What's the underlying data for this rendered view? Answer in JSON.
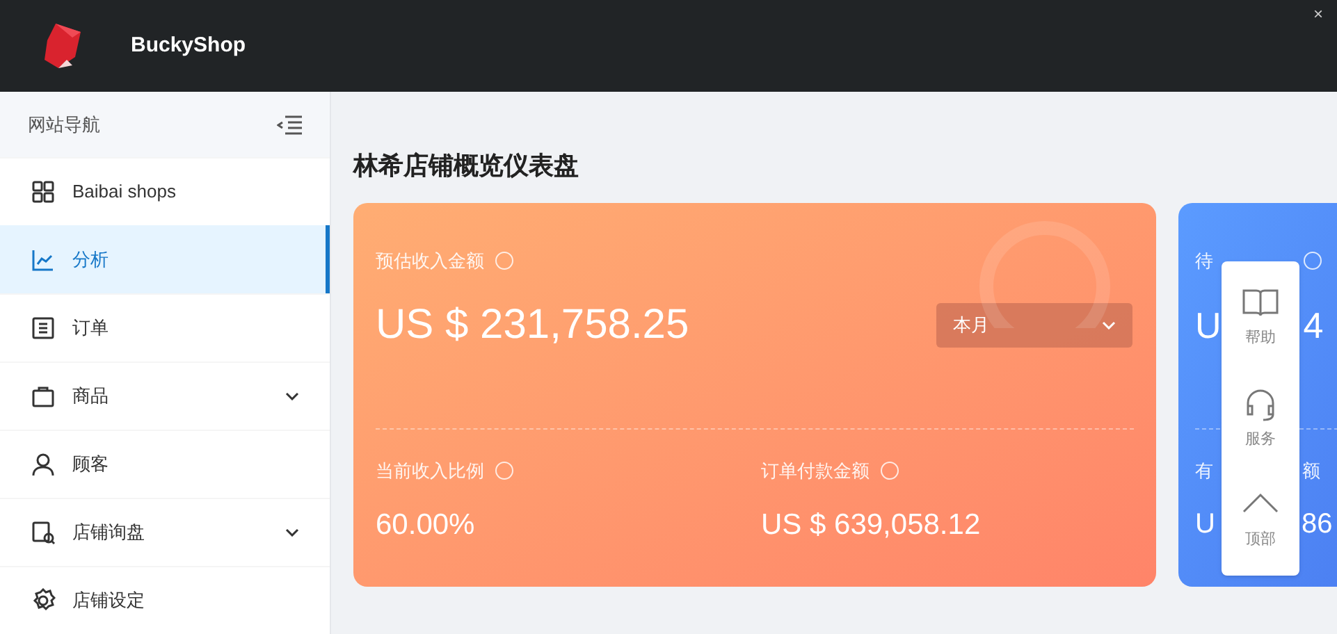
{
  "header": {
    "brand": "BuckyShop",
    "close": "×"
  },
  "sidebar": {
    "title": "网站导航",
    "items": [
      {
        "label": "Baibai shops",
        "selected": false,
        "expandable": false
      },
      {
        "label": "分析",
        "selected": true,
        "expandable": false
      },
      {
        "label": "订单",
        "selected": false,
        "expandable": false
      },
      {
        "label": "商品",
        "selected": false,
        "expandable": true
      },
      {
        "label": "顾客",
        "selected": false,
        "expandable": false
      },
      {
        "label": "店铺询盘",
        "selected": false,
        "expandable": true
      },
      {
        "label": "店铺设定",
        "selected": false,
        "expandable": false
      }
    ]
  },
  "page_title": "林希店铺概览仪表盘",
  "revenue_card": {
    "label": "预估收入金额",
    "amount": "US $ 231,758.25",
    "period": "本月",
    "ratio_label": "当前收入比例",
    "ratio": "60.00%",
    "paid_label": "订单付款金额",
    "paid": "US $ 639,058.12"
  },
  "blue_card": {
    "label_start": "待",
    "amount_start": "U",
    "amount_end": "4",
    "label2_start": "有",
    "label2_end": "额",
    "amount2_start": "U",
    "amount2_end": "86"
  },
  "float_panel": [
    {
      "label": "帮助"
    },
    {
      "label": "服务"
    },
    {
      "label": "顶部"
    }
  ]
}
